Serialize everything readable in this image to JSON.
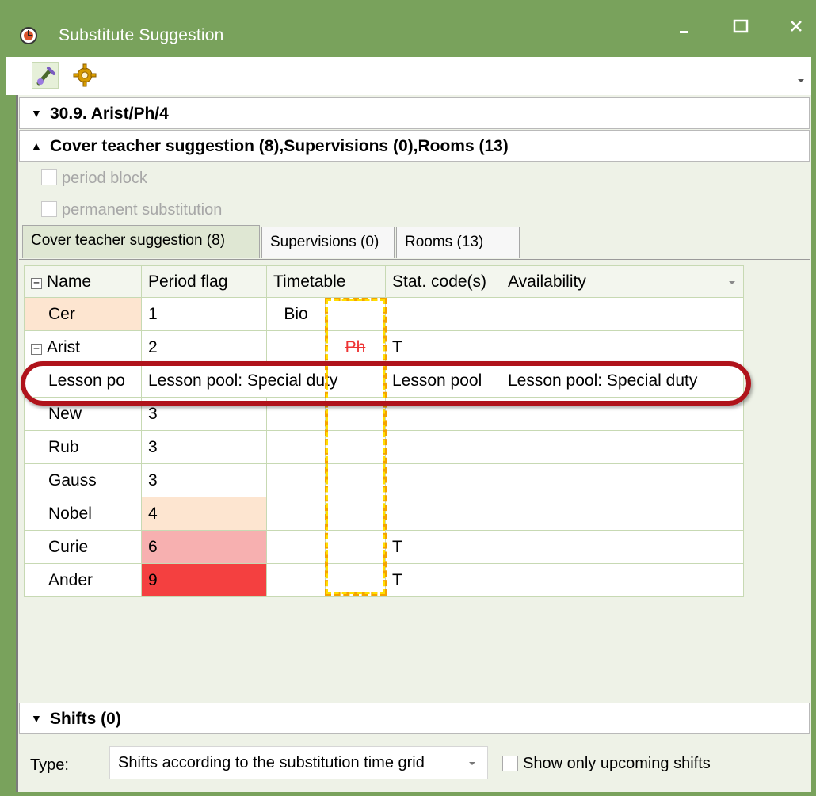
{
  "window": {
    "title": "Substitute Suggestion",
    "minimize_glyph": "−",
    "maximize_glyph": "□",
    "close_glyph": "✕"
  },
  "toolbar": {
    "icons": [
      "edit-wand-icon",
      "settings-gear-icon"
    ]
  },
  "sections": {
    "lesson": {
      "label": "30.9.  Arist/Ph/4",
      "expanded": false
    },
    "suggestion": {
      "label": "Cover teacher suggestion (8),Supervisions (0),Rooms (13)",
      "expanded": true
    },
    "shifts": {
      "label": "Shifts (0)",
      "expanded": false
    }
  },
  "options": {
    "period_block": "period block",
    "permanent_substitution": "permanent substitution"
  },
  "tabs": [
    {
      "label": "Cover teacher suggestion (8)",
      "active": true
    },
    {
      "label": "Supervisions (0)",
      "active": false
    },
    {
      "label": "Rooms (13)",
      "active": false
    }
  ],
  "grid": {
    "columns": [
      "Name",
      "Period flag",
      "Timetable",
      "Stat. code(s)",
      "Availability"
    ],
    "rows": [
      {
        "name": "Cer",
        "flag": "1",
        "tt1": "Bio",
        "tt2": "",
        "stat": "",
        "avail": ""
      },
      {
        "name": "Arist",
        "flag": "2",
        "tt1": "",
        "tt2": "Ph",
        "stat": "T",
        "avail": ""
      },
      {
        "name": "Lesson po",
        "flag": "Lesson pool: Special duty",
        "tt1": "",
        "tt2": "",
        "stat": "Lesson pool",
        "avail": "Lesson pool: Special duty"
      },
      {
        "name": "New",
        "flag": "3",
        "tt1": "",
        "tt2": "",
        "stat": "",
        "avail": ""
      },
      {
        "name": "Rub",
        "flag": "3",
        "tt1": "",
        "tt2": "",
        "stat": "",
        "avail": ""
      },
      {
        "name": "Gauss",
        "flag": "3",
        "tt1": "",
        "tt2": "",
        "stat": "",
        "avail": ""
      },
      {
        "name": "Nobel",
        "flag": "4",
        "tt1": "",
        "tt2": "",
        "stat": "",
        "avail": ""
      },
      {
        "name": "Curie",
        "flag": "6",
        "tt1": "",
        "tt2": "",
        "stat": "T",
        "avail": ""
      },
      {
        "name": "Ander",
        "flag": "9",
        "tt1": "",
        "tt2": "",
        "stat": "T",
        "avail": ""
      }
    ]
  },
  "shifts": {
    "type_label": "Type:",
    "type_value": "Shifts according to the substitution time grid",
    "upcoming_label": "Show only upcoming shifts"
  },
  "colors": {
    "frame_green": "#79a25c",
    "highlight_oval": "#b0131b",
    "flag_peach": "#fde5d0",
    "flag_pink": "#f7b0b0",
    "flag_red": "#f44040"
  }
}
